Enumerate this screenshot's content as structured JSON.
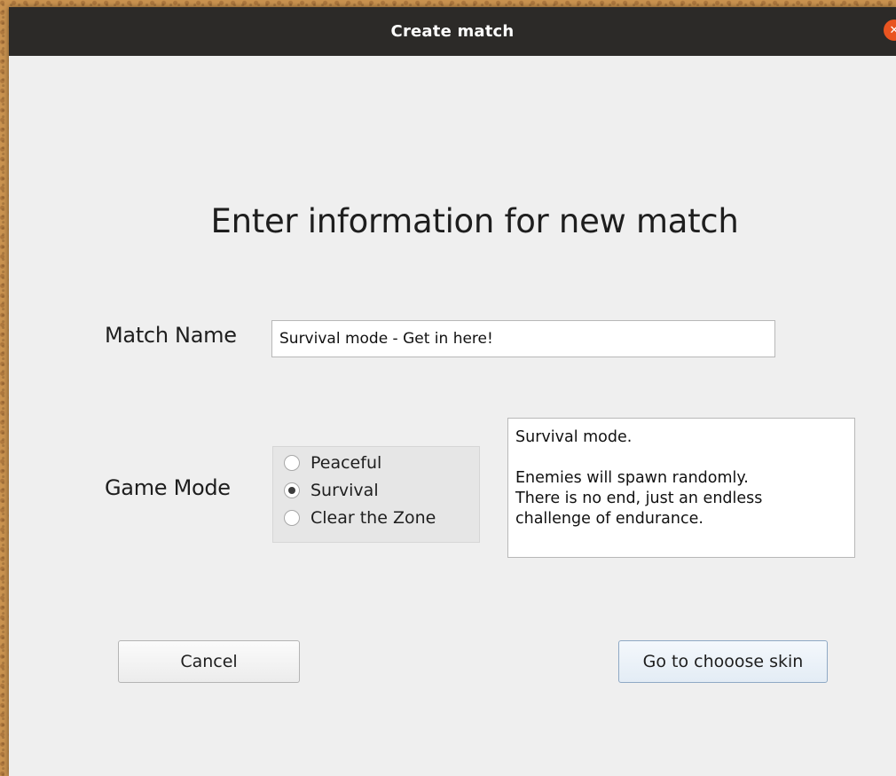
{
  "window": {
    "title": "Create match",
    "close_icon": "close-icon",
    "accent": "#e95420"
  },
  "form": {
    "heading": "Enter information for new match",
    "match_name_label": "Match Name",
    "match_name_value": "Survival mode - Get in here!",
    "game_mode_label": "Game Mode",
    "modes": [
      {
        "label": "Peaceful",
        "selected": false
      },
      {
        "label": "Survival",
        "selected": true
      },
      {
        "label": "Clear the Zone",
        "selected": false
      }
    ],
    "description": {
      "line1": "Survival mode.",
      "line2": "Enemies will spawn randomly.",
      "line3": "There is no end, just an endless",
      "line4": "challenge of endurance."
    }
  },
  "buttons": {
    "cancel": "Cancel",
    "next": "Go to chooose skin"
  }
}
